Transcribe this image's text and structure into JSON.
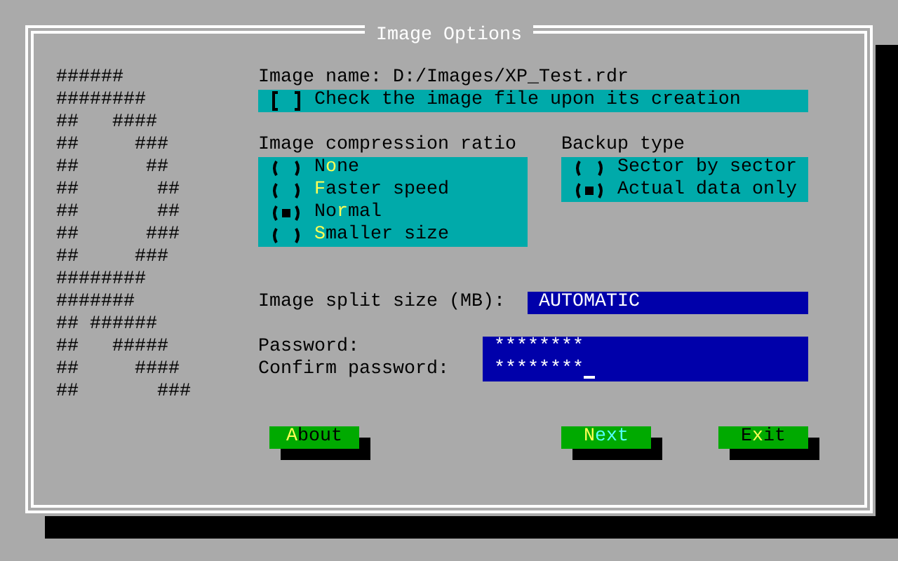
{
  "window": {
    "title": "Image Options"
  },
  "logo_art": [
    "######",
    "########",
    "##   ####",
    "##     ###",
    "##      ##",
    "##       ##",
    "##       ##",
    "##      ###",
    "##     ###",
    "########",
    "#######",
    "## ######",
    "##   #####",
    "##     ####",
    "##       ###"
  ],
  "image_name": {
    "label": "Image name:",
    "value": "D:/Images/XP_Test.rdr"
  },
  "verify_checkbox": {
    "label": "Check the image file upon its creation",
    "checked": false
  },
  "compression": {
    "title": "Image compression ratio",
    "options": [
      {
        "parts": [
          {
            "text": "N",
            "hotkey": false
          },
          {
            "text": "o",
            "hotkey": true
          },
          {
            "text": "ne",
            "hotkey": false
          }
        ],
        "selected": false
      },
      {
        "parts": [
          {
            "text": "F",
            "hotkey": true
          },
          {
            "text": "aster speed",
            "hotkey": false
          }
        ],
        "selected": false
      },
      {
        "parts": [
          {
            "text": "No",
            "hotkey": false
          },
          {
            "text": "r",
            "hotkey": true
          },
          {
            "text": "mal",
            "hotkey": false
          }
        ],
        "selected": true
      },
      {
        "parts": [
          {
            "text": "S",
            "hotkey": true
          },
          {
            "text": "maller size",
            "hotkey": false
          }
        ],
        "selected": false
      }
    ]
  },
  "backup": {
    "title": "Backup type",
    "options": [
      {
        "parts": [
          {
            "text": "Sector by sector",
            "hotkey": false
          }
        ],
        "selected": false
      },
      {
        "parts": [
          {
            "text": "Actual data only",
            "hotkey": false
          }
        ],
        "selected": true
      }
    ]
  },
  "split_size": {
    "label": "Image split size (MB):",
    "value": "AUTOMATIC"
  },
  "password": {
    "label": "Password:",
    "value": "********",
    "cursor": false
  },
  "confirm_password": {
    "label": "Confirm password:",
    "value": "********",
    "cursor": true
  },
  "buttons": [
    {
      "parts": [
        {
          "text": "A",
          "hotkey": true
        },
        {
          "text": "bout",
          "hotkey": false
        }
      ],
      "focused": false
    },
    {
      "parts": [
        {
          "text": "N",
          "hotkey": true
        },
        {
          "text": "ext",
          "hotkey": false
        }
      ],
      "focused": true
    },
    {
      "parts": [
        {
          "text": "E",
          "hotkey": false
        },
        {
          "text": "x",
          "hotkey": true
        },
        {
          "text": "it",
          "hotkey": false
        }
      ],
      "focused": false
    }
  ]
}
